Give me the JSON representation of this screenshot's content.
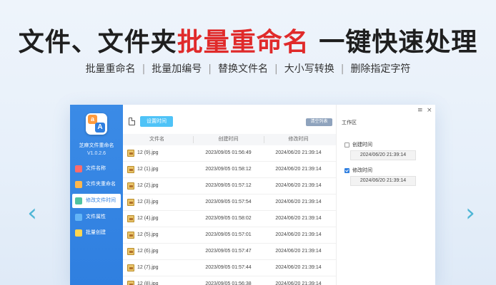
{
  "hero": {
    "title_pre": "文件、文件夹",
    "title_highlight": "批量重命名",
    "title_post": " 一键快速处理",
    "features": [
      "批量重命名",
      "批量加编号",
      "替换文件名",
      "大小写转换",
      "删除指定字符"
    ],
    "separator": "|"
  },
  "nav": {
    "prev_arrow": "‹",
    "next_arrow": "›"
  },
  "app": {
    "name": "芝麻文件重命名",
    "version": "V1.0.2.6",
    "logo_a": "a",
    "logo_b": "A",
    "sidebar": [
      {
        "label": "文件名称",
        "icon": "rename-icon",
        "color": "#ff6b6b",
        "active": false
      },
      {
        "label": "文件夹重命名",
        "icon": "folder-icon",
        "color": "#ffb74d",
        "active": false
      },
      {
        "label": "修改文件时间",
        "icon": "clock-icon",
        "color": "#4fc3a1",
        "active": true
      },
      {
        "label": "文件属性",
        "icon": "file-icon",
        "color": "#64b5f6",
        "active": false
      },
      {
        "label": "批量创建",
        "icon": "plus-icon",
        "color": "#ffd54f",
        "active": false
      }
    ],
    "toolbar": {
      "set_time_button": "设置时间",
      "clear_list_button": "清空列表"
    },
    "table": {
      "headers": [
        "文件名",
        "创建时间",
        "修改时间"
      ],
      "rows": [
        {
          "name": "12 (9).jpg",
          "created": "2023/09/05 01:56:49",
          "modified": "2024/06/20 21:39:14"
        },
        {
          "name": "12 (1).jpg",
          "created": "2023/09/05 01:58:12",
          "modified": "2024/06/20 21:39:14"
        },
        {
          "name": "12 (2).jpg",
          "created": "2023/09/05 01:57:12",
          "modified": "2024/06/20 21:39:14"
        },
        {
          "name": "12 (3).jpg",
          "created": "2023/09/05 01:57:54",
          "modified": "2024/06/20 21:39:14"
        },
        {
          "name": "12 (4).jpg",
          "created": "2023/09/05 01:58:02",
          "modified": "2024/06/20 21:39:14"
        },
        {
          "name": "12 (5).jpg",
          "created": "2023/09/05 01:57:01",
          "modified": "2024/06/20 21:39:14"
        },
        {
          "name": "12 (6).jpg",
          "created": "2023/09/05 01:57:47",
          "modified": "2024/06/20 21:39:14"
        },
        {
          "name": "12 (7).jpg",
          "created": "2023/09/05 01:57:44",
          "modified": "2024/06/20 21:39:14"
        },
        {
          "name": "12 (8).jpg",
          "created": "2023/09/05 01:56:38",
          "modified": "2024/06/20 21:39:14"
        }
      ]
    },
    "panel": {
      "menu_icon": "≡",
      "close_icon": "×",
      "title": "工作区",
      "create_time": {
        "label": "创建时间",
        "checked": false,
        "value": "2024/06/20 21:39:14"
      },
      "modify_time": {
        "label": "修改时间",
        "checked": true,
        "value": "2024/06/20 21:39:14"
      }
    }
  }
}
